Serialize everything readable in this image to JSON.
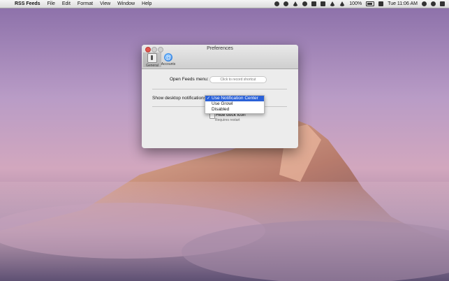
{
  "menubar": {
    "apple_glyph": "",
    "app_name": "RSS Feeds",
    "menus": [
      "File",
      "Edit",
      "Format",
      "View",
      "Window",
      "Help"
    ],
    "battery": "100%",
    "clock": "Tue 11:06 AM",
    "status_icons": [
      "rss-icon",
      "cloud-icon",
      "bell-icon",
      "notifications-icon",
      "lock-icon",
      "display-icon",
      "bluetooth-icon",
      "wifi-icon",
      "battery-icon",
      "user-icon",
      "spotlight-icon",
      "list-icon"
    ]
  },
  "window": {
    "title": "Preferences",
    "toolbar": [
      {
        "label": "General",
        "icon": "switch-icon",
        "selected": true
      },
      {
        "label": "Accounts",
        "icon": "at-icon",
        "selected": false
      }
    ],
    "open_feeds_label": "Open Feeds menu:",
    "shortcut_placeholder": "Click to record shortcut",
    "notifications_label": "Show desktop notifications",
    "notification_options": [
      {
        "label": "Use Notification Center",
        "selected": true
      },
      {
        "label": "Use Growl",
        "selected": false
      },
      {
        "label": "Disabled",
        "selected": false
      }
    ],
    "check_glyph": "✓",
    "hide_dock_label": "Hide dock icon",
    "hide_dock_checked": false,
    "requires_restart": "Requires restart"
  },
  "colors": {
    "menu_highlight": "#2a61d8",
    "close_button": "#e5564e"
  }
}
